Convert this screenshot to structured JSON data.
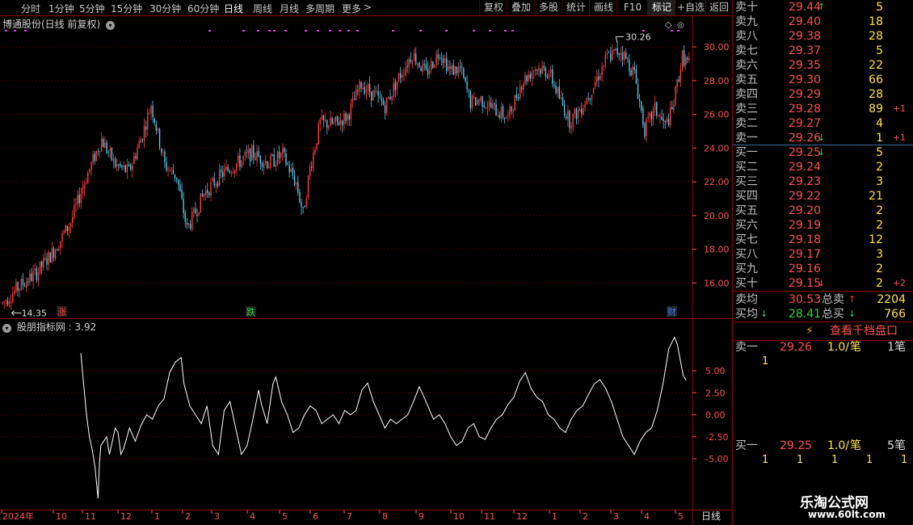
{
  "toolbar": {
    "periods": [
      {
        "label": "分时",
        "x": 26
      },
      {
        "label": "1分钟",
        "x": 60
      },
      {
        "label": "5分钟",
        "x": 98
      },
      {
        "label": "15分钟",
        "x": 137
      },
      {
        "label": "30分钟",
        "x": 185
      },
      {
        "label": "60分钟",
        "x": 232
      },
      {
        "label": "日线",
        "x": 277,
        "active": true
      },
      {
        "label": "周线",
        "x": 313
      },
      {
        "label": "月线",
        "x": 346
      },
      {
        "label": "多周期",
        "x": 378
      },
      {
        "label": "更多",
        "x": 423
      }
    ],
    "more_arrow": ">",
    "tools": [
      {
        "label": "复权",
        "x": 593,
        "w": 34
      },
      {
        "label": "叠加",
        "x": 627,
        "w": 34
      },
      {
        "label": "多股",
        "x": 661,
        "w": 34
      },
      {
        "label": "统计",
        "x": 695,
        "w": 34
      },
      {
        "label": "画线",
        "x": 729,
        "w": 34
      },
      {
        "label": "F10",
        "x": 763,
        "w": 38
      },
      {
        "label": "标记",
        "x": 801,
        "w": 34,
        "active": true
      },
      {
        "label": "+自选",
        "x": 835,
        "w": 38
      },
      {
        "label": "返回",
        "x": 873,
        "w": 32
      }
    ]
  },
  "stock": {
    "title": "博通股份(日线 前复权)"
  },
  "indicator": {
    "title": "股朋指标网 : 3.92"
  },
  "chart_data": [
    {
      "type": "candlestick",
      "ylim": [
        14.0,
        31.3
      ],
      "yticks": [
        "16.00",
        "18.00",
        "20.00",
        "22.00",
        "24.00",
        "26.00",
        "28.00",
        "30.00"
      ],
      "xticks": [
        "2024年",
        "10",
        "11",
        "12",
        "1",
        "2",
        "3",
        "4",
        "5",
        "6",
        "7",
        "8",
        "9",
        "10",
        "11",
        "12",
        "1",
        "2",
        "3",
        "4",
        "5"
      ],
      "annotations": {
        "high": "30.26",
        "low": "14.35"
      },
      "markers": [
        "涨",
        "跌",
        "财"
      ],
      "period_label": "日线",
      "control_points": [
        [
          0,
          14.8
        ],
        [
          10,
          15.8
        ],
        [
          20,
          16.6
        ],
        [
          30,
          17.9
        ],
        [
          40,
          19.6
        ],
        [
          48,
          22.0
        ],
        [
          58,
          24.5
        ],
        [
          66,
          23.0
        ],
        [
          74,
          22.6
        ],
        [
          82,
          24.8
        ],
        [
          87,
          26.6
        ],
        [
          95,
          23.0
        ],
        [
          102,
          22.3
        ],
        [
          108,
          19.2
        ],
        [
          112,
          20.0
        ],
        [
          118,
          21.3
        ],
        [
          128,
          22.4
        ],
        [
          136,
          23.0
        ],
        [
          146,
          23.7
        ],
        [
          156,
          23.1
        ],
        [
          164,
          23.6
        ],
        [
          172,
          21.9
        ],
        [
          176,
          20.1
        ],
        [
          180,
          22.8
        ],
        [
          186,
          25.5
        ],
        [
          194,
          25.4
        ],
        [
          202,
          25.9
        ],
        [
          210,
          27.8
        ],
        [
          218,
          27.1
        ],
        [
          224,
          26.5
        ],
        [
          232,
          28.2
        ],
        [
          240,
          29.6
        ],
        [
          248,
          28.4
        ],
        [
          256,
          29.8
        ],
        [
          262,
          28.6
        ],
        [
          268,
          28.7
        ],
        [
          274,
          26.7
        ],
        [
          280,
          26.9
        ],
        [
          288,
          26.3
        ],
        [
          296,
          25.8
        ],
        [
          304,
          27.9
        ],
        [
          312,
          28.8
        ],
        [
          320,
          28.5
        ],
        [
          326,
          27.0
        ],
        [
          332,
          25.6
        ],
        [
          338,
          26.3
        ],
        [
          344,
          27.3
        ],
        [
          354,
          29.4
        ],
        [
          362,
          29.8
        ],
        [
          370,
          28.4
        ],
        [
          376,
          25.1
        ],
        [
          382,
          26.3
        ],
        [
          388,
          25.3
        ],
        [
          392,
          26.2
        ],
        [
          398,
          29.4
        ],
        [
          402,
          29.0
        ]
      ]
    },
    {
      "type": "line",
      "name": "股朋指标网",
      "ylim": [
        -10.5,
        9.5
      ],
      "yticks": [
        "5.00",
        "2.50",
        "0.00",
        "-2.50",
        "-5.00"
      ],
      "last": 3.92,
      "control_points": [
        [
          0,
          7.0
        ],
        [
          2,
          3.5
        ],
        [
          4,
          0.0
        ],
        [
          6,
          -2.5
        ],
        [
          8,
          -4.0
        ],
        [
          10,
          -6.0
        ],
        [
          12,
          -9.5
        ],
        [
          13,
          -5.5
        ],
        [
          14,
          -3.5
        ],
        [
          18,
          -2.5
        ],
        [
          20,
          -4.5
        ],
        [
          24,
          -1.5
        ],
        [
          26,
          -2.0
        ],
        [
          28,
          -4.5
        ],
        [
          30,
          -3.8
        ],
        [
          34,
          -1.5
        ],
        [
          38,
          -3.0
        ],
        [
          42,
          -1.2
        ],
        [
          46,
          0.0
        ],
        [
          50,
          -0.5
        ],
        [
          54,
          1.0
        ],
        [
          58,
          1.8
        ],
        [
          62,
          4.8
        ],
        [
          66,
          6.0
        ],
        [
          70,
          6.5
        ],
        [
          72,
          3.5
        ],
        [
          76,
          1.0
        ],
        [
          80,
          0.0
        ],
        [
          84,
          -1.0
        ],
        [
          88,
          1.0
        ],
        [
          92,
          -3.5
        ],
        [
          96,
          -4.5
        ],
        [
          100,
          0.5
        ],
        [
          104,
          1.5
        ],
        [
          108,
          -1.5
        ],
        [
          112,
          -4.5
        ],
        [
          116,
          -3.5
        ],
        [
          120,
          -0.5
        ],
        [
          124,
          2.8
        ],
        [
          126,
          1.2
        ],
        [
          130,
          -1.0
        ],
        [
          134,
          3.5
        ],
        [
          136,
          4.3
        ],
        [
          140,
          1.5
        ],
        [
          144,
          0.0
        ],
        [
          148,
          -2.0
        ],
        [
          152,
          -1.5
        ],
        [
          156,
          0.0
        ],
        [
          160,
          1.0
        ],
        [
          164,
          0.5
        ],
        [
          168,
          -1.0
        ],
        [
          172,
          -0.5
        ],
        [
          176,
          0.0
        ],
        [
          180,
          -1.0
        ],
        [
          184,
          0.5
        ],
        [
          188,
          0.0
        ],
        [
          192,
          0.5
        ],
        [
          196,
          2.8
        ],
        [
          200,
          3.6
        ],
        [
          204,
          1.5
        ],
        [
          208,
          0.0
        ],
        [
          212,
          -1.5
        ],
        [
          216,
          -0.5
        ],
        [
          220,
          -1.0
        ],
        [
          224,
          -0.5
        ],
        [
          228,
          0.0
        ],
        [
          232,
          1.5
        ],
        [
          236,
          3.2
        ],
        [
          238,
          2.5
        ],
        [
          242,
          1.0
        ],
        [
          246,
          -0.5
        ],
        [
          250,
          0.0
        ],
        [
          254,
          -1.0
        ],
        [
          258,
          -2.5
        ],
        [
          262,
          -3.5
        ],
        [
          266,
          -3.0
        ],
        [
          270,
          -1.5
        ],
        [
          274,
          -1.0
        ],
        [
          278,
          -2.5
        ],
        [
          282,
          -2.8
        ],
        [
          286,
          -1.5
        ],
        [
          290,
          -0.5
        ],
        [
          294,
          0.0
        ],
        [
          298,
          1.2
        ],
        [
          302,
          2.0
        ],
        [
          306,
          3.8
        ],
        [
          310,
          4.8
        ],
        [
          314,
          3.0
        ],
        [
          318,
          2.0
        ],
        [
          322,
          1.5
        ],
        [
          326,
          0.0
        ],
        [
          330,
          -0.5
        ],
        [
          334,
          -1.5
        ],
        [
          338,
          -2.0
        ],
        [
          342,
          -0.5
        ],
        [
          346,
          0.5
        ],
        [
          350,
          1.0
        ],
        [
          354,
          2.3
        ],
        [
          358,
          3.5
        ],
        [
          362,
          4.0
        ],
        [
          366,
          3.0
        ],
        [
          370,
          1.5
        ],
        [
          374,
          -0.5
        ],
        [
          378,
          -2.5
        ],
        [
          382,
          -3.5
        ],
        [
          386,
          -4.5
        ],
        [
          390,
          -3.0
        ],
        [
          394,
          -2.0
        ],
        [
          398,
          -1.5
        ],
        [
          402,
          0.5
        ],
        [
          406,
          3.5
        ],
        [
          410,
          7.5
        ],
        [
          414,
          8.8
        ],
        [
          416,
          8.0
        ],
        [
          420,
          4.5
        ],
        [
          422,
          3.92
        ]
      ]
    }
  ],
  "orderbook": {
    "asks": [
      {
        "label": "卖十",
        "price": "29.44",
        "vol": "5",
        "arrow": "↑"
      },
      {
        "label": "卖九",
        "price": "29.40",
        "vol": "18"
      },
      {
        "label": "卖八",
        "price": "29.38",
        "vol": "28"
      },
      {
        "label": "卖七",
        "price": "29.37",
        "vol": "5"
      },
      {
        "label": "卖六",
        "price": "29.35",
        "vol": "22"
      },
      {
        "label": "卖五",
        "price": "29.30",
        "vol": "66"
      },
      {
        "label": "卖四",
        "price": "29.29",
        "vol": "28"
      },
      {
        "label": "卖三",
        "price": "29.28",
        "vol": "89",
        "chg": "+1"
      },
      {
        "label": "卖二",
        "price": "29.27",
        "vol": "4"
      },
      {
        "label": "卖一",
        "price": "29.26",
        "vol": "1",
        "chg": "+1",
        "arrow": "↓"
      }
    ],
    "bids": [
      {
        "label": "买一",
        "price": "29.25",
        "vol": "5",
        "arrow": "↓"
      },
      {
        "label": "买二",
        "price": "29.24",
        "vol": "2"
      },
      {
        "label": "买三",
        "price": "29.23",
        "vol": "3"
      },
      {
        "label": "买四",
        "price": "29.22",
        "vol": "21"
      },
      {
        "label": "买五",
        "price": "29.20",
        "vol": "2"
      },
      {
        "label": "买六",
        "price": "29.19",
        "vol": "2"
      },
      {
        "label": "买七",
        "price": "29.18",
        "vol": "12"
      },
      {
        "label": "买八",
        "price": "29.17",
        "vol": "3"
      },
      {
        "label": "买九",
        "price": "29.16",
        "vol": "2"
      },
      {
        "label": "买十",
        "price": "29.15",
        "vol": "2",
        "chg": "+2",
        "arrow": "↓"
      }
    ],
    "summary": {
      "sell_avg_label": "卖均",
      "sell_avg": "30.53",
      "sell_total_label": "总卖",
      "sell_total": "2204",
      "buy_avg_label": "买均",
      "buy_avg": "28.41",
      "buy_total_label": "总买",
      "buy_total": "766"
    },
    "depth_button": "查看千档盘口",
    "detail_ask": {
      "label": "卖一",
      "price": "29.26",
      "qty": "1.0/",
      "unit": "笔",
      "count": "1笔",
      "queue": [
        "1"
      ]
    },
    "detail_bid": {
      "label": "买一",
      "price": "29.25",
      "qty": "1.0/",
      "unit": "笔",
      "count": "5笔",
      "queue": [
        "1",
        "1",
        "1",
        "1",
        "1"
      ]
    }
  },
  "watermark": {
    "name": "乐淘公式网",
    "url": "www.60lt.com"
  },
  "colors": {
    "up": "#ff3b3b",
    "down": "#54c8e8",
    "grid": "#6e0000",
    "border": "#8b0000",
    "axis": "#ff5050",
    "text_yellow": "#ffe24a"
  }
}
